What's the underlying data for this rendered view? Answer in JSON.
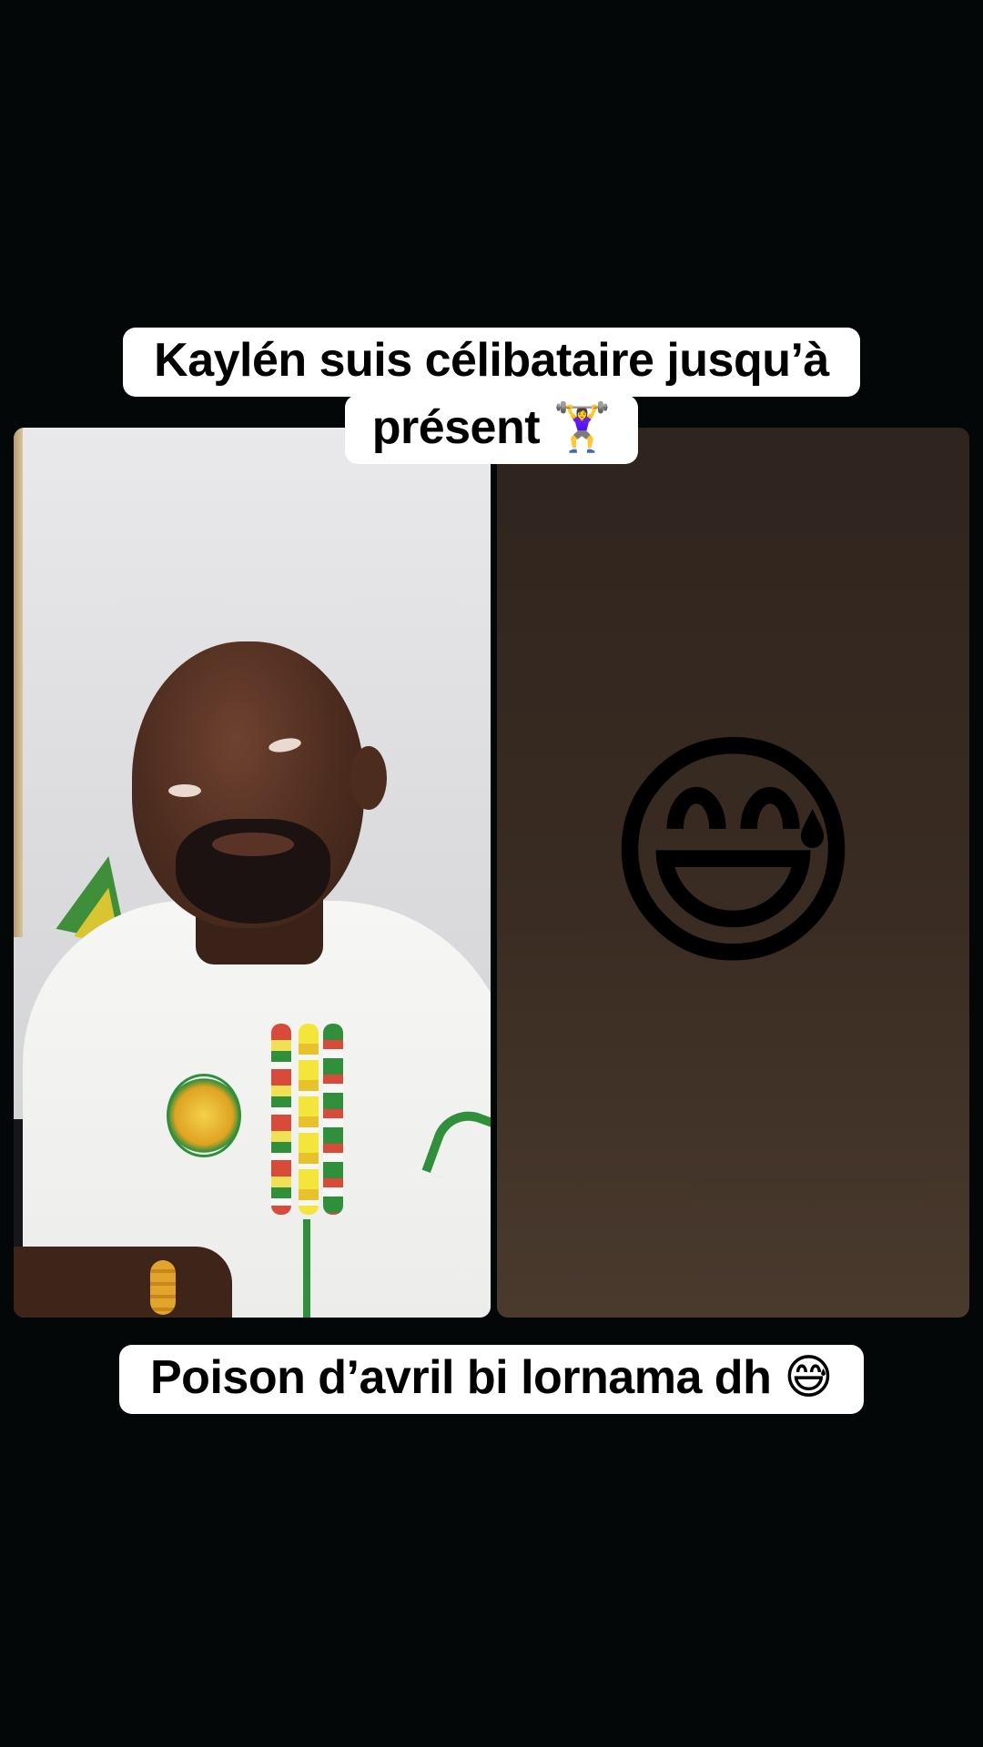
{
  "captions": {
    "top_line1": "Kaylén suis célibataire jusqu’à",
    "top_line2": "présent 🏋️‍♀️",
    "bottom": "Poison d’avril bi lornama dh 😅"
  },
  "right_panel": {
    "emoji": "😅",
    "emoji_name": "grinning-face-with-sweat-icon"
  },
  "colors": {
    "background": "#040707",
    "caption_bg": "#ffffff",
    "caption_text": "#000000",
    "right_panel": "#3a2c22"
  }
}
